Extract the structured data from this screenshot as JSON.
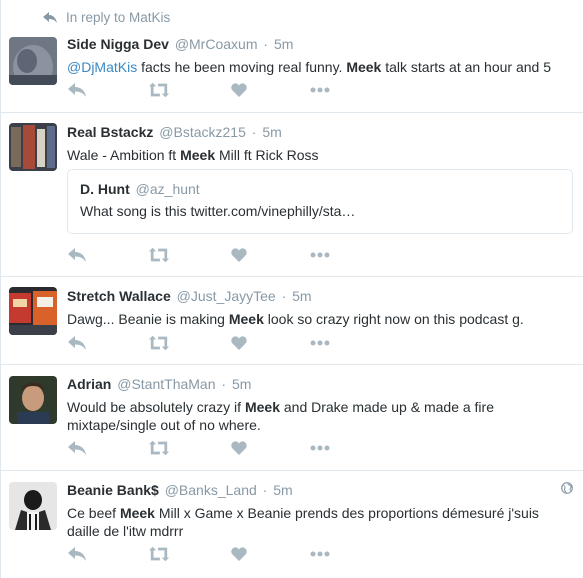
{
  "reply_context": {
    "label": "In reply to MatKis"
  },
  "tweets": [
    {
      "name": "Side Nigga Dev",
      "handle": "@MrCoaxum",
      "time": "5m",
      "text_parts": [
        "@DjMatKis",
        " facts he been moving real funny. ",
        "Meek",
        " talk starts at an hour and 5"
      ]
    },
    {
      "name": "Real Bstackz",
      "handle": "@Bstackz215",
      "time": "5m",
      "text_parts": [
        "Wale - Ambition ft ",
        "Meek",
        " Mill ft Rick Ross"
      ],
      "quote": {
        "name": "D. Hunt",
        "handle": "@az_hunt",
        "text": "What song is this twitter.com/vinephilly/sta…"
      }
    },
    {
      "name": "Stretch Wallace",
      "handle": "@Just_JayyTee",
      "time": "5m",
      "text_parts": [
        "Dawg... Beanie is making ",
        "Meek",
        " look so crazy right now on this podcast g."
      ]
    },
    {
      "name": "Adrian",
      "handle": "@StantThaMan",
      "time": "5m",
      "text_parts": [
        "Would be absolutely crazy if ",
        "Meek",
        " and Drake made up & made a fire",
        "mixtape/single out of no where."
      ]
    },
    {
      "name": "Beanie Bank$",
      "handle": "@Banks_Land",
      "time": "5m",
      "text_parts": [
        "Ce beef ",
        "Meek",
        " Mill x Game x Beanie prends des proportions démesuré j'suis",
        "daille de l'itw mdrrr"
      ]
    }
  ],
  "separator": "·",
  "colors": {
    "muted": "#8899a6",
    "text": "#292f33",
    "link": "#3b88c3",
    "border": "#e1e8ed",
    "icon": "#aab8c2"
  },
  "icons": [
    "reply-icon",
    "retweet-icon",
    "like-icon",
    "more-icon",
    "globe-icon"
  ]
}
